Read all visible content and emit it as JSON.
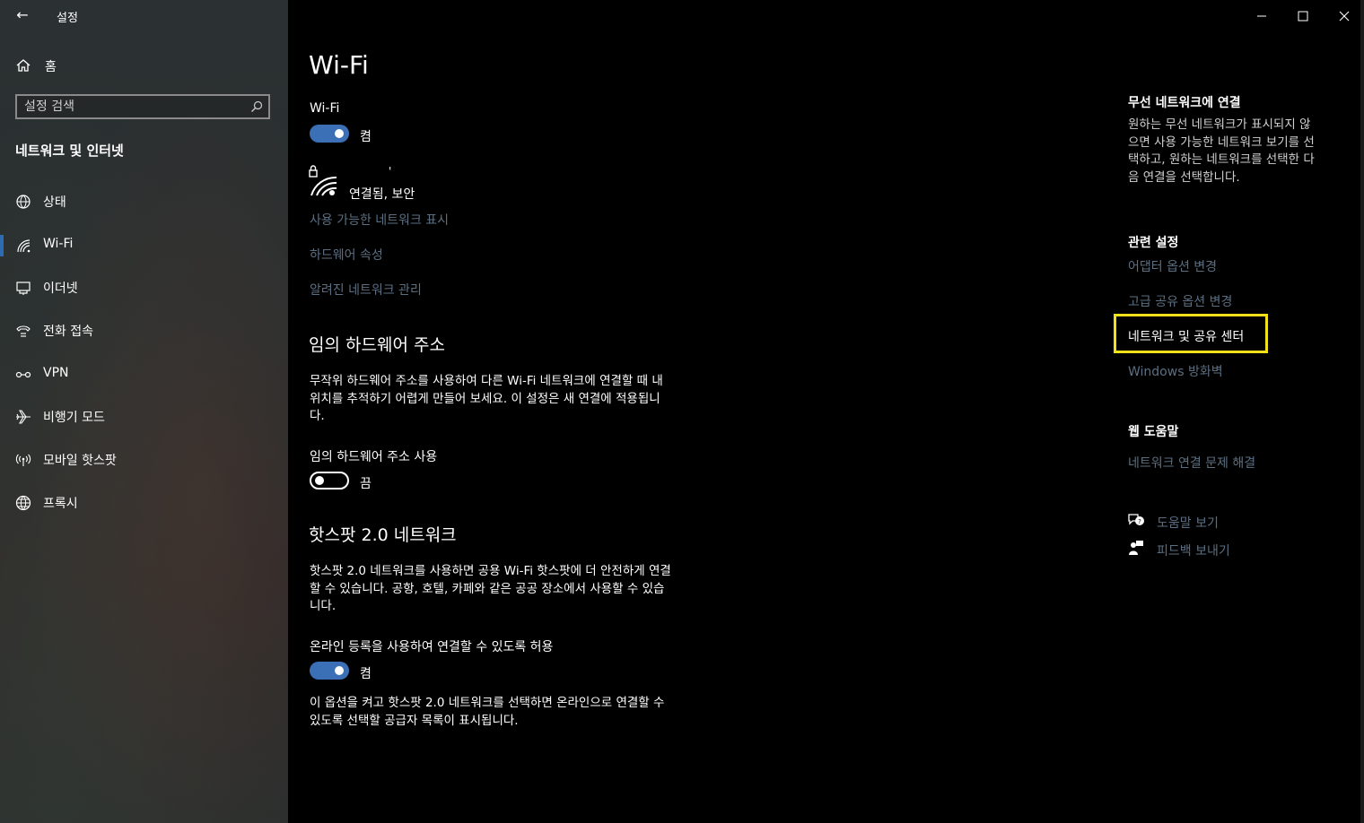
{
  "window": {
    "title": "설정",
    "back_icon": "back-arrow-icon",
    "controls": [
      "minimize-icon",
      "maximize-icon",
      "close-icon"
    ]
  },
  "sidebar": {
    "home_label": "홈",
    "search_placeholder": "설정 검색",
    "section_title": "네트워크 및 인터넷",
    "items": [
      {
        "label": "상태",
        "icon": "globe-status-icon"
      },
      {
        "label": "Wi-Fi",
        "icon": "wifi-icon",
        "active": true
      },
      {
        "label": "이더넷",
        "icon": "ethernet-icon"
      },
      {
        "label": "전화 접속",
        "icon": "dialup-icon"
      },
      {
        "label": "VPN",
        "icon": "vpn-icon"
      },
      {
        "label": "비행기 모드",
        "icon": "airplane-icon"
      },
      {
        "label": "모바일 핫스팟",
        "icon": "hotspot-icon"
      },
      {
        "label": "프록시",
        "icon": "globe-proxy-icon"
      }
    ],
    "accent_color": "#2d6bb3"
  },
  "main": {
    "title": "Wi-Fi",
    "wifi_label": "Wi-Fi",
    "wifi_toggle_state": "켬",
    "network_name": "'",
    "network_status": "연결됨, 보안",
    "links": [
      "사용 가능한 네트워크 표시",
      "하드웨어 속성",
      "알려진 네트워크 관리"
    ],
    "random_hw": {
      "heading": "임의 하드웨어 주소",
      "description_lines": [
        "무작위 하드웨어 주소를 사용하여 다른 Wi-Fi 네트워크에 연결할 때 내",
        "위치를 추적하기 어렵게 만들어 보세요. 이 설정은 새 연결에 적용됩니",
        "다."
      ],
      "toggle_label": "임의 하드웨어 주소 사용",
      "toggle_state": "끔"
    },
    "hotspot2": {
      "heading": "핫스팟 2.0 네트워크",
      "description_lines": [
        "핫스팟 2.0 네트워크를 사용하면 공용 Wi-Fi 핫스팟에 더 안전하게 연결",
        "할 수 있습니다. 공항, 호텔, 카페와 같은 공공 장소에서 사용할 수 있습",
        "니다."
      ],
      "toggle_label": "온라인 등록을 사용하여 연결할 수 있도록 허용",
      "toggle_state": "켬",
      "note_lines": [
        "이 옵션을 켜고 핫스팟 2.0 네트워크를 선택하면 온라인으로 연결할 수",
        "있도록 선택할 공급자 목록이 표시됩니다."
      ]
    }
  },
  "right_panel": {
    "connect": {
      "heading": "무선 네트워크에 연결",
      "lines": [
        "원하는 무선 네트워크가 표시되지 않",
        "으면 사용 가능한 네트워크 보기를 선",
        "택하고, 원하는 네트워크를 선택한 다",
        "음 연결을 선택합니다."
      ]
    },
    "related": {
      "heading": "관련 설정",
      "links": [
        "어댑터 옵션 변경",
        "고급 공유 옵션 변경",
        "네트워크 및 공유 센터",
        "Windows 방화벽"
      ],
      "highlighted_index": 2,
      "highlight_color": "#f2e11a"
    },
    "web_help": {
      "heading": "웹 도움말",
      "link": "네트워크 연결 문제 해결"
    },
    "help": {
      "help_label": "도움말 보기",
      "feedback_label": "피드백 보내기"
    }
  }
}
